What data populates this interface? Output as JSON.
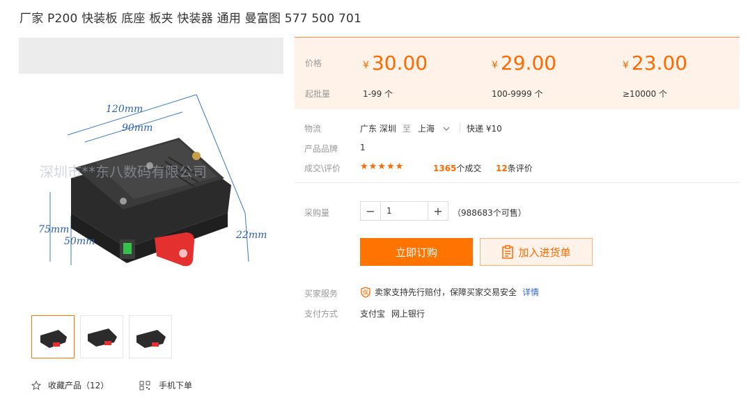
{
  "title": "厂家 P200 快装板 底座 板夹 快装器 通用 曼富图 577 500 701",
  "image": {
    "watermark": "深圳市**东八数码有限公司",
    "dims": {
      "w120": "120mm",
      "w90": "90mm",
      "h75": "75mm",
      "h50": "50mm",
      "d22": "22mm"
    }
  },
  "actions": {
    "favorite_label": "收藏产品（12）",
    "mobile_label": "手机下单"
  },
  "price": {
    "price_label": "价格",
    "moq_label": "起批量",
    "currency": "¥",
    "tiers": [
      {
        "price": "30.00",
        "range": "1-99 个"
      },
      {
        "price": "29.00",
        "range": "100-9999 个"
      },
      {
        "price": "23.00",
        "range": "≥10000 个"
      }
    ]
  },
  "logistics": {
    "label": "物流",
    "from": "广东 深圳",
    "to_word": "至",
    "to": "上海",
    "shipping": "快递 ¥10"
  },
  "brand": {
    "label": "产品品牌",
    "value": "1"
  },
  "deals": {
    "label": "成交\\评价",
    "stars": "★★★★★",
    "rating": 5,
    "deal_count": "1365",
    "deal_suffix": "个成交",
    "review_count": "12",
    "review_suffix": "条评价"
  },
  "purchase": {
    "label": "采购量",
    "minus": "−",
    "qty": "1",
    "plus": "+",
    "stock": "（988683个可售）"
  },
  "buttons": {
    "buy": "立即订购",
    "cart": "加入进货单"
  },
  "service": {
    "label": "买家服务",
    "icon_char": "保",
    "text": "卖家支持先行赔付，保障买家交易安全",
    "link": "详情"
  },
  "payment": {
    "label": "支付方式",
    "methods": [
      "支付宝",
      "网上银行"
    ]
  },
  "colors": {
    "accent": "#ff6a00",
    "panel_bg": "#fff2e8",
    "link": "#3366cc"
  }
}
